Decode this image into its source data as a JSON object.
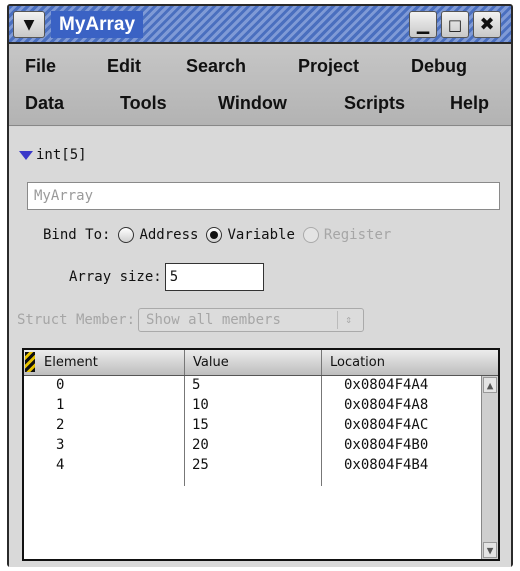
{
  "window": {
    "title": "MyArray",
    "menu_glyph": "▼",
    "min_glyph": "▁",
    "max_glyph": "□",
    "close_glyph": "✖"
  },
  "menubar": {
    "row1": [
      "File",
      "Edit",
      "Search",
      "Project",
      "Debug"
    ],
    "row2": [
      "Data",
      "Tools",
      "Window",
      "Scripts",
      "Help"
    ]
  },
  "type_label": "int[5]",
  "name_field": {
    "value": "MyArray"
  },
  "bind": {
    "label": "Bind To:",
    "options": [
      "Address",
      "Variable",
      "Register"
    ],
    "selected": "Variable"
  },
  "array_size": {
    "label": "Array size:",
    "value": "5"
  },
  "struct_member": {
    "label": "Struct Member:",
    "value": "Show all members",
    "arrows": "⇕"
  },
  "table": {
    "columns": [
      "Element",
      "Value",
      "Location"
    ],
    "rows": [
      [
        "0",
        "5",
        "0x0804F4A4"
      ],
      [
        "1",
        "10",
        "0x0804F4A8"
      ],
      [
        "2",
        "15",
        "0x0804F4AC"
      ],
      [
        "3",
        "20",
        "0x0804F4B0"
      ],
      [
        "4",
        "25",
        "0x0804F4B4"
      ]
    ]
  },
  "colors": {
    "titlebar": "#4a6fbf",
    "title_bg": "#3a62c4",
    "disclosure": "#3a38c9"
  }
}
